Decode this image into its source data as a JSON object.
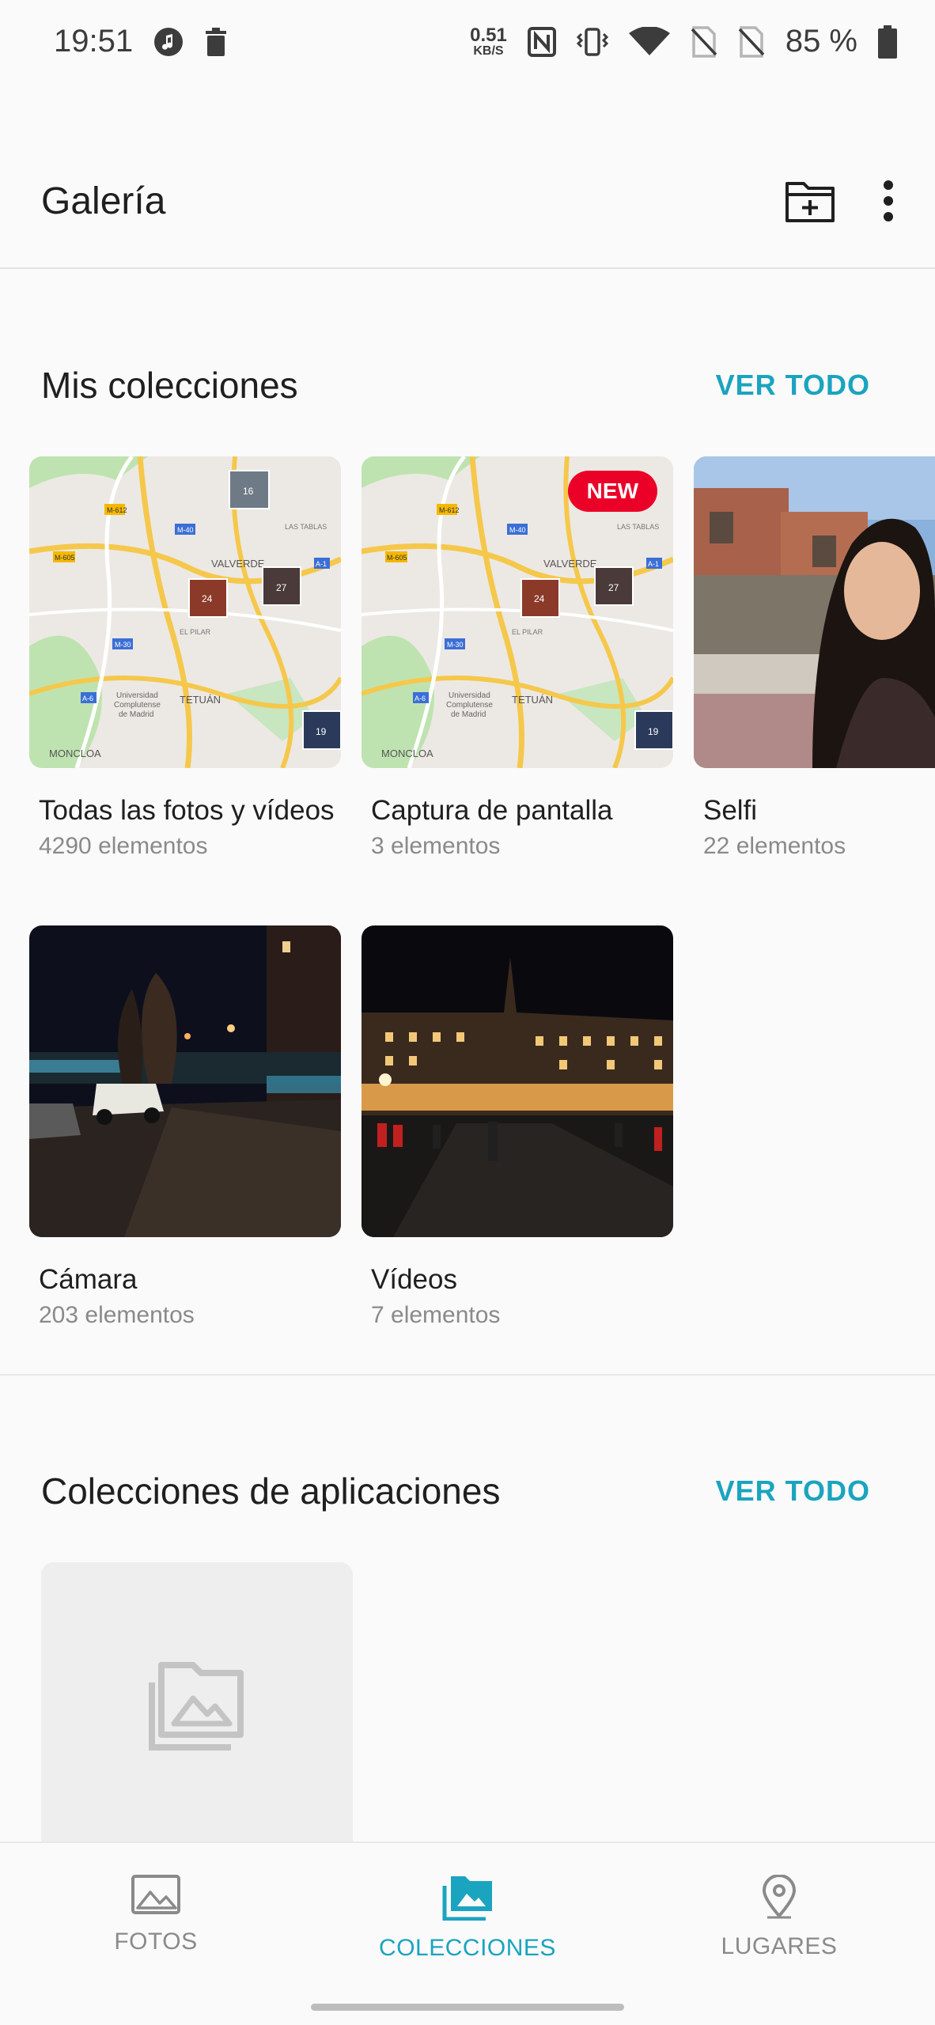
{
  "status_bar": {
    "time": "19:51",
    "net_speed_value": "0.51",
    "net_speed_unit": "KB/S",
    "battery": "85 %"
  },
  "app_bar": {
    "title": "Galería"
  },
  "my_collections": {
    "title": "Mis colecciones",
    "see_all": "VER TODO",
    "albums": [
      {
        "name": "Todas las fotos y vídeos",
        "count": "4290 elementos"
      },
      {
        "name": "Captura de pantalla",
        "count": "3 elementos",
        "badge": "NEW"
      },
      {
        "name": "Selfi",
        "count": "22 elementos"
      },
      {
        "name": "Cámara",
        "count": "203 elementos"
      },
      {
        "name": "Vídeos",
        "count": "7 elementos"
      }
    ],
    "map_labels": {
      "valverde": "VALVERDE",
      "tetuan": "TETUÁN",
      "pilar": "EL PILAR",
      "tablas": "LAS TABLAS",
      "moncloa": "MONCLOA",
      "univ1": "Universidad",
      "univ2": "Complutense",
      "univ3": "de Madrid",
      "m612": "M-612",
      "m40": "M-40",
      "m605": "M-605",
      "m30": "M-30",
      "a1": "A-1",
      "a6": "A-6",
      "n1": "16",
      "n2": "24",
      "n3": "27",
      "n4": "19"
    }
  },
  "app_collections": {
    "title": "Colecciones de aplicaciones",
    "see_all": "VER TODO"
  },
  "bottom_nav": {
    "items": [
      {
        "label": "FOTOS",
        "icon": "photo-icon",
        "active": false
      },
      {
        "label": "COLECCIONES",
        "icon": "collections-icon",
        "active": true
      },
      {
        "label": "LUGARES",
        "icon": "location-pin-icon",
        "active": false
      }
    ]
  },
  "colors": {
    "accent": "#1aa4bf",
    "badge": "#eb0028"
  }
}
